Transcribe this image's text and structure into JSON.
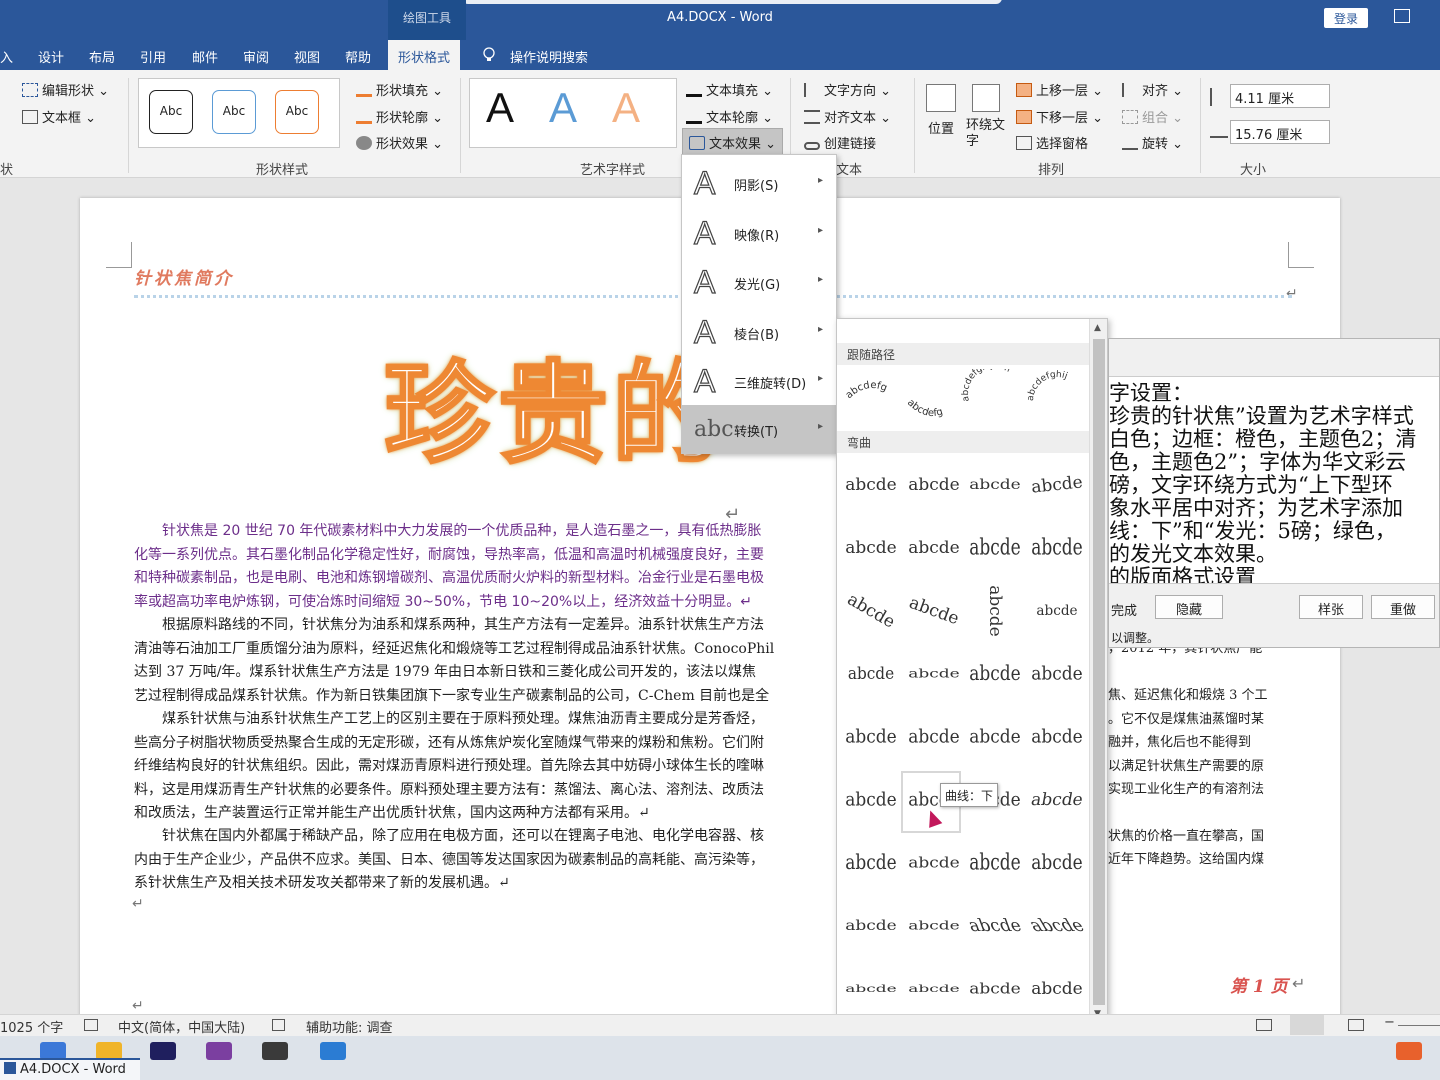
{
  "titlebar": {
    "context_tab": "绘图工具",
    "title": "A4.DOCX  -  Word",
    "login": "登录"
  },
  "tabs": [
    "入",
    "设计",
    "布局",
    "引用",
    "邮件",
    "审阅",
    "视图",
    "帮助",
    "形状格式"
  ],
  "tell_me": "操作说明搜索",
  "ribbon": {
    "edit_shape": "编辑形状",
    "text_box": "文本框",
    "insert_shape_group": "状",
    "style_label": "Abc",
    "shape_fill": "形状填充",
    "shape_outline": "形状轮廓",
    "shape_effects": "形状效果",
    "shape_styles_group": "形状样式",
    "wordart_letter": "A",
    "text_fill": "文本填充",
    "text_outline": "文本轮廓",
    "text_effects": "文本效果",
    "wordart_group": "艺术字样式",
    "text_direction": "文字方向",
    "align_text": "对齐文本",
    "create_link": "创建链接",
    "text_group": "文本",
    "position": "位置",
    "wrap_text": "环绕文字",
    "bring_forward": "上移一层",
    "send_backward": "下移一层",
    "selection_pane": "选择窗格",
    "align": "对齐",
    "group": "组合",
    "rotate": "旋转",
    "arrange_group": "排列",
    "height": "4.11 厘米",
    "width": "15.76 厘米",
    "size_group": "大小"
  },
  "document": {
    "heading": "针状焦简介",
    "wordart": "珍贵的",
    "return_mark": "↵",
    "paragraphs": [
      {
        "style": "purple",
        "lines": [
          "　　针状焦是 20 世纪 70 年代碳素材料中大力发展的一个优质品种，是人造石墨之一，具有低热膨胀",
          "化等一系列优点。其石墨化制品化学稳定性好，耐腐蚀，导热率高，低温和高温时机械强度良好，主要",
          "和特种碳素制品，也是电刷、电池和炼钢增碳剂、高温优质耐火炉料的新型材料。冶金行业是石墨电极",
          "率或超高功率电炉炼钢，可使冶炼时间缩短 30~50%，节电 10~20%以上，经济效益十分明显。↵"
        ]
      },
      {
        "style": "normal",
        "lines": [
          "　　根据原料路线的不同，针状焦分为油系和煤系两种，其生产方法有一定差异。油系针状焦生产方法",
          "清油等石油加工厂重质馏分油为原料，经延迟焦化和煅烧等工艺过程制得成品油系针状焦。ConocoPhil",
          "达到 37 万吨/年。煤系针状焦生产方法是 1979 年由日本新日铁和三菱化成公司开发的，该法以煤焦",
          "艺过程制得成品煤系针状焦。作为新日铁集团旗下一家专业生产碳素制品的公司，C-Chem 目前也是全"
        ]
      },
      {
        "style": "normal",
        "lines": [
          "　　煤系针状焦与油系针状焦生产工艺上的区别主要在于原料预处理。煤焦油沥青主要成分是芳香烃，",
          "些高分子树脂状物质受热聚合生成的无定形碳，还有从炼焦炉炭化室随煤气带来的煤粉和焦粉。它们附",
          "纤维结构良好的针状焦组织。因此，需对煤沥青原料进行预处理。首先除去其中妨碍小球体生长的喹啉",
          "料，这是用煤沥青生产针状焦的必要条件。原料预处理主要方法有：蒸馏法、离心法、溶剂法、改质法",
          "和改质法，生产装置运行正常并能生产出优质针状焦，国内这两种方法都有采用。↵"
        ]
      },
      {
        "style": "normal",
        "lines": [
          "　　针状焦在国内外都属于稀缺产品，除了应用在电极方面，还可以在锂离子电池、电化学电容器、核",
          "内由于生产企业少，产品供不应求。美国、日本、德国等发达国家因为碳素制品的高耗能、高污染等，",
          "系针状焦生产及相关技术研发攻关都带来了新的发展机遇。↵"
        ]
      }
    ],
    "right_fragments": [
      "，2012 年，其针状焦产能",
      "焦、延迟焦化和煅烧 3 个工",
      "。它不仅是煤焦油蒸馏时某",
      "融并，焦化后也不能得到",
      "以满足针状焦生产需要的原",
      "实现工业化生产的有溶剂法",
      "状焦的价格一直在攀高，国",
      "近年下降趋势。这给国内煤"
    ],
    "page_number": "第 1 页"
  },
  "effects_menu": [
    {
      "label": "阴影(S)"
    },
    {
      "label": "映像(R)"
    },
    {
      "label": "发光(G)"
    },
    {
      "label": "棱台(B)"
    },
    {
      "label": "三维旋转(D)"
    },
    {
      "label": "转换(T)"
    }
  ],
  "transform_menu": {
    "follow_path": "跟随路径",
    "warp": "弯曲",
    "sample": "abcde",
    "path_samples": [
      "abcdefg",
      "abcdefghijklm",
      "abcdefghij"
    ],
    "tooltip": "曲线：下"
  },
  "pane": {
    "lines": [
      "字设置：",
      "珍贵的针状焦”设置为艺术字样式",
      "白色；边框：橙色，主题色2；清",
      "色，主题色2”；字体为华文彩云",
      "磅，文字环绕方式为“上下型环",
      "象水平居中对齐；为艺术字添加",
      "线：下”和“发光：5磅；绿色，",
      "的发光文本效果。",
      "的版面格式设置"
    ],
    "done": "完成",
    "hide": "隐藏",
    "sample_btn": "样张",
    "redo_btn": "重做",
    "hint": "以调整。"
  },
  "status": {
    "words": "1025 个字",
    "language": "中文(简体，中国大陆)",
    "accessibility": "辅助功能: 调查"
  },
  "taskbar": {
    "word_task": "A4.DOCX - Word"
  }
}
